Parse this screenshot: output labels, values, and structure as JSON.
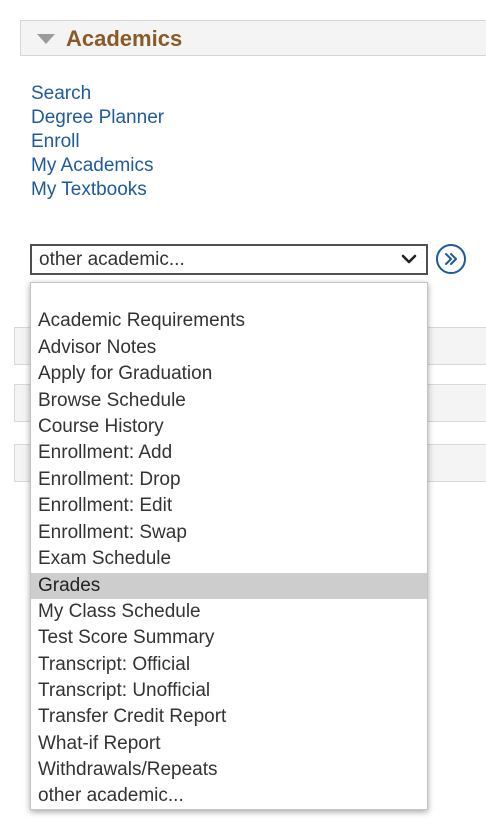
{
  "section": {
    "title": "Academics"
  },
  "links": [
    "Search",
    "Degree Planner",
    "Enroll",
    "My Academics",
    "My Textbooks"
  ],
  "select": {
    "value": "other academic...",
    "icon": "chevron-down-icon"
  },
  "go_button": {
    "icon": "double-chevron-right-icon",
    "color": "#1e5a9e"
  },
  "dropdown": {
    "selected": "Grades",
    "options": [
      "",
      "Academic Requirements",
      "Advisor Notes",
      "Apply for Graduation",
      "Browse Schedule",
      "Course History",
      "Enrollment: Add",
      "Enrollment: Drop",
      "Enrollment: Edit",
      "Enrollment: Swap",
      "Exam Schedule",
      "Grades",
      "My Class Schedule",
      "Test Score Summary",
      "Transcript: Official",
      "Transcript: Unofficial",
      "Transfer Credit Report",
      "What-if Report",
      "Withdrawals/Repeats",
      "other academic..."
    ]
  },
  "colors": {
    "title": "#8a5a27",
    "link": "#1e5a9e",
    "highlight": "#cdcdcd"
  }
}
